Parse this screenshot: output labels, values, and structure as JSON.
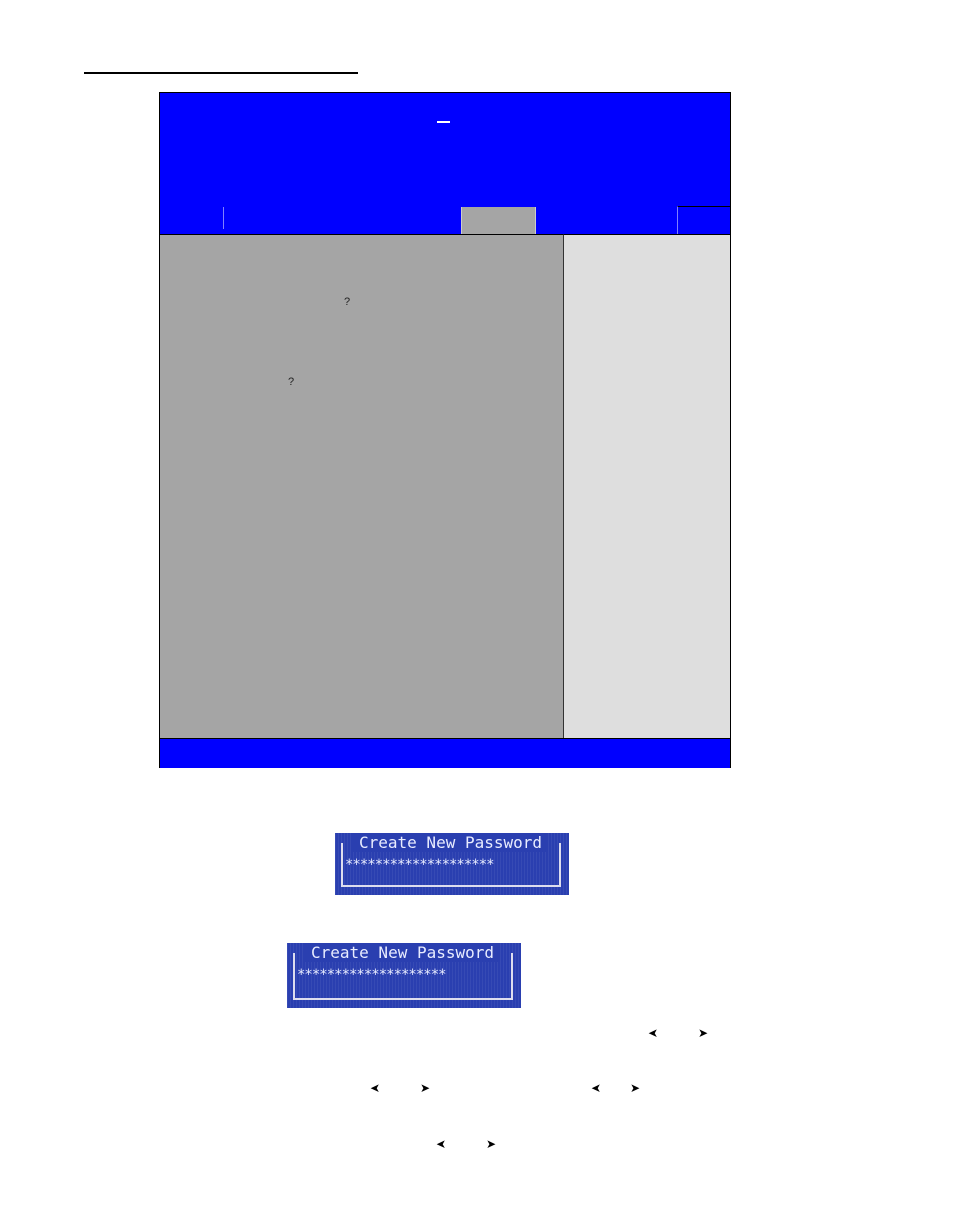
{
  "bios": {
    "main_marks": [
      "?",
      "?"
    ],
    "colors": {
      "header": "#0000ff",
      "main": "#a5a5a5",
      "help": "#dedede"
    }
  },
  "dialogs": [
    {
      "title": "Create New Password",
      "value": "********************"
    },
    {
      "title": "Create New Password",
      "value": "********************"
    }
  ],
  "arrows": {
    "left": "➤",
    "right": "➤"
  }
}
